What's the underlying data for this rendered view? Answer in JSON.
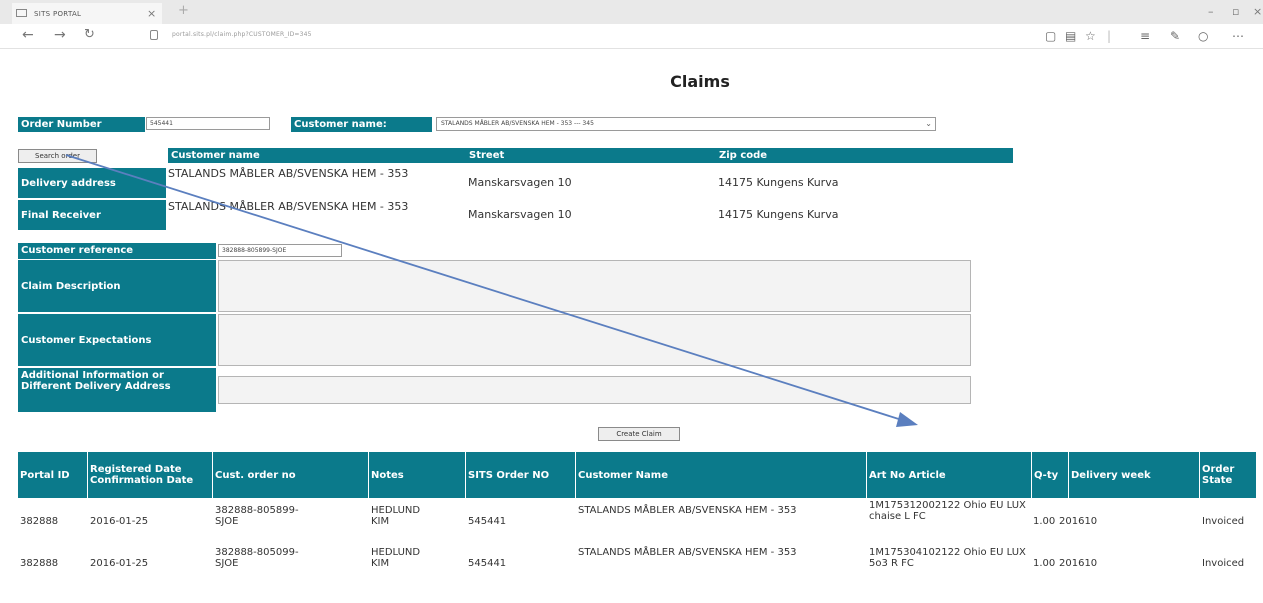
{
  "browser": {
    "tab_title": "SITS PORTAL",
    "tab_close": "×",
    "new_tab": "+",
    "url": "portal.sits.pl/claim.php?CUSTOMER_ID=345",
    "win_min": "–",
    "win_max": "▫",
    "win_close": "×"
  },
  "page": {
    "title": "Claims"
  },
  "form": {
    "order_number_label": "Order Number",
    "order_number_value": "545441",
    "customer_name_label": "Customer name:",
    "customer_name_selected": "STALANDS MÅBLER AB/SVENSKA HEM - 353 --- 345",
    "search_button": "Search order"
  },
  "address": {
    "headers": [
      "Customer name",
      "Street",
      "Zip code"
    ],
    "rows": [
      {
        "label": "Delivery address",
        "name": "STALANDS MÅBLER AB/SVENSKA HEM - 353",
        "street": "Manskarsvagen 10",
        "zip": "14175 Kungens Kurva"
      },
      {
        "label": "Final Receiver",
        "name": "STALANDS MÅBLER AB/SVENSKA HEM - 353",
        "street": "Manskarsvagen 10",
        "zip": "14175 Kungens Kurva"
      }
    ]
  },
  "claim": {
    "customer_reference_label": "Customer reference",
    "customer_reference_value": "382888-805899-SJOE",
    "claim_description_label": "Claim Description",
    "customer_expectations_label": "Customer Expectations",
    "additional_info_label": "Additional Information or Different Delivery Address",
    "create_button": "Create Claim"
  },
  "orders": {
    "headers": [
      "Portal ID",
      "Registered Date Confirmation Date",
      "Cust. order no",
      "Notes",
      "SITS Order NO",
      "Customer Name",
      "Art No Article",
      "Q-ty",
      "Delivery week",
      "Order State"
    ],
    "rows": [
      {
        "portal_id": "382888",
        "date": "2016-01-25",
        "cust_order": "382888-805899-SJOE",
        "notes": "HEDLUND KIM",
        "sits_order": "545441",
        "customer": "STALANDS MÅBLER AB/SVENSKA HEM - 353",
        "article": "1M175312002122 Ohio EU LUX chaise L FC",
        "qty": "1.00",
        "week": "201610",
        "state": "Invoiced"
      },
      {
        "portal_id": "382888",
        "date": "2016-01-25",
        "cust_order": "382888-805099-SJOE",
        "notes": "HEDLUND KIM",
        "sits_order": "545441",
        "customer": "STALANDS MÅBLER AB/SVENSKA HEM - 353",
        "article": "1M175304102122 Ohio EU LUX 5o3 R FC",
        "qty": "1.00",
        "week": "201610",
        "state": "Invoiced"
      }
    ]
  },
  "colors": {
    "header_teal": "#0b7a8b",
    "arrow_blue": "#5b7fbf"
  }
}
